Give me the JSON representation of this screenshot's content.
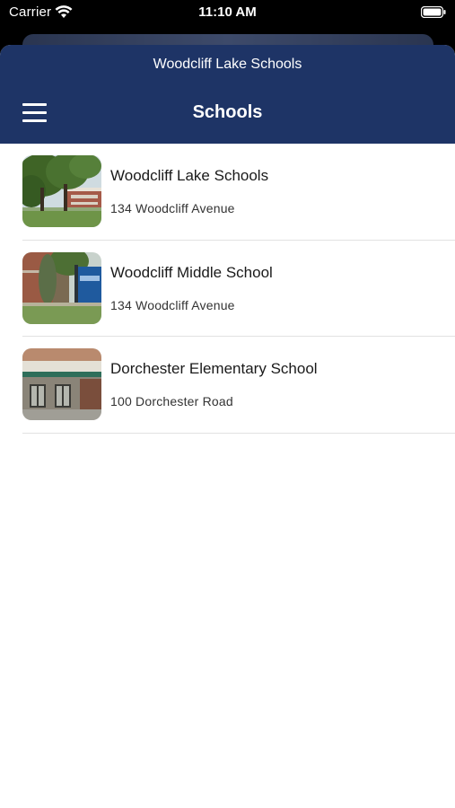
{
  "status_bar": {
    "carrier": "Carrier",
    "time": "11:10 AM",
    "icons": [
      "wifi-icon",
      "battery-icon"
    ]
  },
  "header": {
    "subtitle": "Woodcliff Lake Schools",
    "title": "Schools",
    "menu_icon": "hamburger-menu-icon",
    "background_color": "#1e3466"
  },
  "schools": [
    {
      "name": "Woodcliff Lake Schools",
      "address": "134 Woodcliff Avenue",
      "thumbnail": "school-photo-trees-building"
    },
    {
      "name": "Woodcliff Middle School",
      "address": "134 Woodcliff Avenue",
      "thumbnail": "school-photo-sign"
    },
    {
      "name": "Dorchester Elementary School",
      "address": "100 Dorchester Road",
      "thumbnail": "school-photo-entrance"
    }
  ]
}
